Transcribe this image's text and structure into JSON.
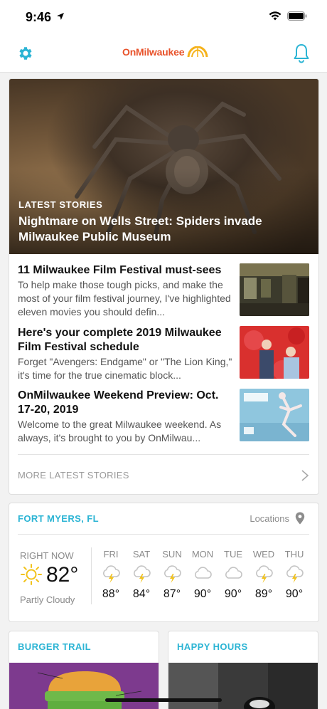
{
  "status": {
    "time": "9:46"
  },
  "header": {
    "logo_on": "On",
    "logo_mke": "Milwaukee",
    "accent": "#2bb4d4"
  },
  "latest": {
    "kicker": "LATEST STORIES",
    "hero_title": "Nightmare on Wells Street: Spiders invade Milwaukee Public Museum",
    "stories": [
      {
        "title": "11 Milwaukee Film Festival must-sees",
        "desc": "To help make those tough picks, and make the most of your film festival journey, I've highlighted eleven movies you should defin..."
      },
      {
        "title": "Here's your complete 2019 Milwaukee Film Festival schedule",
        "desc": "Forget \"Avengers: Endgame\" or \"The Lion King,\" it's time for the true cinematic block..."
      },
      {
        "title": "OnMilwaukee Weekend Preview: Oct. 17-20, 2019",
        "desc": "Welcome to the great Milwaukee weekend. As always, it's brought to you by OnMilwau..."
      }
    ],
    "more_label": "MORE LATEST STORIES"
  },
  "weather": {
    "city": "FORT MYERS, FL",
    "locations_label": "Locations",
    "now_label": "RIGHT NOW",
    "now_temp": "82°",
    "now_condition": "Partly Cloudy",
    "days": [
      {
        "name": "FRI",
        "temp": "88°",
        "icon": "thunderstorm-icon"
      },
      {
        "name": "SAT",
        "temp": "84°",
        "icon": "thunderstorm-icon"
      },
      {
        "name": "SUN",
        "temp": "87°",
        "icon": "thunderstorm-icon"
      },
      {
        "name": "MON",
        "temp": "90°",
        "icon": "cloud-icon"
      },
      {
        "name": "TUE",
        "temp": "90°",
        "icon": "cloud-icon"
      },
      {
        "name": "WED",
        "temp": "89°",
        "icon": "thunderstorm-icon"
      },
      {
        "name": "THU",
        "temp": "90°",
        "icon": "thunderstorm-icon"
      }
    ]
  },
  "tiles": {
    "burger": "BURGER TRAIL",
    "happy": "HAPPY HOURS"
  }
}
